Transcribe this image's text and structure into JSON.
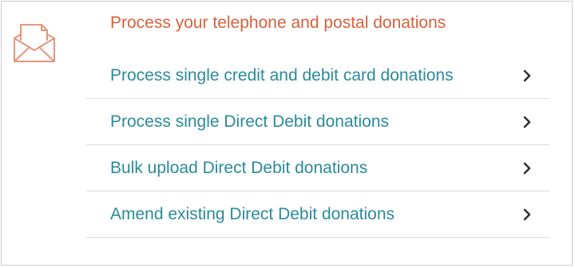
{
  "header": {
    "title": "Process your telephone and postal donations",
    "icon": "envelope-icon"
  },
  "menu": {
    "items": [
      {
        "label": "Process single credit and debit card donations",
        "icon": "chevron-right-icon"
      },
      {
        "label": "Process single Direct Debit donations",
        "icon": "chevron-right-icon"
      },
      {
        "label": "Bulk upload Direct Debit donations",
        "icon": "chevron-right-icon"
      },
      {
        "label": "Amend existing Direct Debit donations",
        "icon": "chevron-right-icon"
      }
    ]
  },
  "colors": {
    "heading": "#d9603b",
    "link": "#2a8a9c",
    "chevron": "#333333",
    "divider": "#dcdcdc",
    "border": "#cfcfcf"
  }
}
